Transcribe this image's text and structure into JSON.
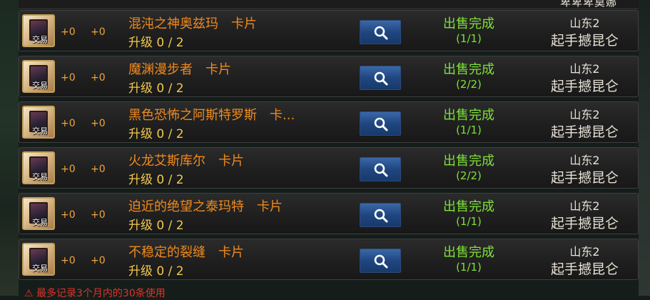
{
  "header": {
    "partial_text": "卑卑卑莫娜"
  },
  "rows": [
    {
      "trade_label": "交易",
      "plus_a": "+0",
      "plus_b": "+0",
      "name": "混沌之神奥兹玛　卡片",
      "upgrade": "升级 0 / 2",
      "status": "出售完成",
      "count": "(1/1)",
      "server": "山东2",
      "player": "起手撼昆仑"
    },
    {
      "trade_label": "交易",
      "plus_a": "+0",
      "plus_b": "+0",
      "name": "魔渊漫步者　卡片",
      "upgrade": "升级 0 / 2",
      "status": "出售完成",
      "count": "(2/2)",
      "server": "山东2",
      "player": "起手撼昆仑"
    },
    {
      "trade_label": "交易",
      "plus_a": "+0",
      "plus_b": "+0",
      "name": "黑色恐怖之阿斯特罗斯　卡...",
      "upgrade": "升级 0 / 2",
      "status": "出售完成",
      "count": "(1/1)",
      "server": "山东2",
      "player": "起手撼昆仑"
    },
    {
      "trade_label": "交易",
      "plus_a": "+0",
      "plus_b": "+0",
      "name": "火龙艾斯库尔　卡片",
      "upgrade": "升级 0 / 2",
      "status": "出售完成",
      "count": "(2/2)",
      "server": "山东2",
      "player": "起手撼昆仑"
    },
    {
      "trade_label": "交易",
      "plus_a": "+0",
      "plus_b": "+0",
      "name": "迫近的绝望之泰玛特　卡片",
      "upgrade": "升级 0 / 2",
      "status": "出售完成",
      "count": "(1/1)",
      "server": "山东2",
      "player": "起手撼昆仑"
    },
    {
      "trade_label": "交易",
      "plus_a": "+0",
      "plus_b": "+0",
      "name": "不稳定的裂缝　卡片",
      "upgrade": "升级 0 / 2",
      "status": "出售完成",
      "count": "(1/1)",
      "server": "山东2",
      "player": "起手撼昆仑"
    }
  ],
  "footer": {
    "note": "⚠ 最多记录3个月内的30条使用"
  },
  "icons": {
    "search": "magnifier-icon",
    "item": "card-item-icon"
  },
  "colors": {
    "name": "#f08a1c",
    "upgrade": "#f2c94c",
    "status": "#7ee037",
    "button": "#1f4680",
    "warning": "#e0322a"
  }
}
